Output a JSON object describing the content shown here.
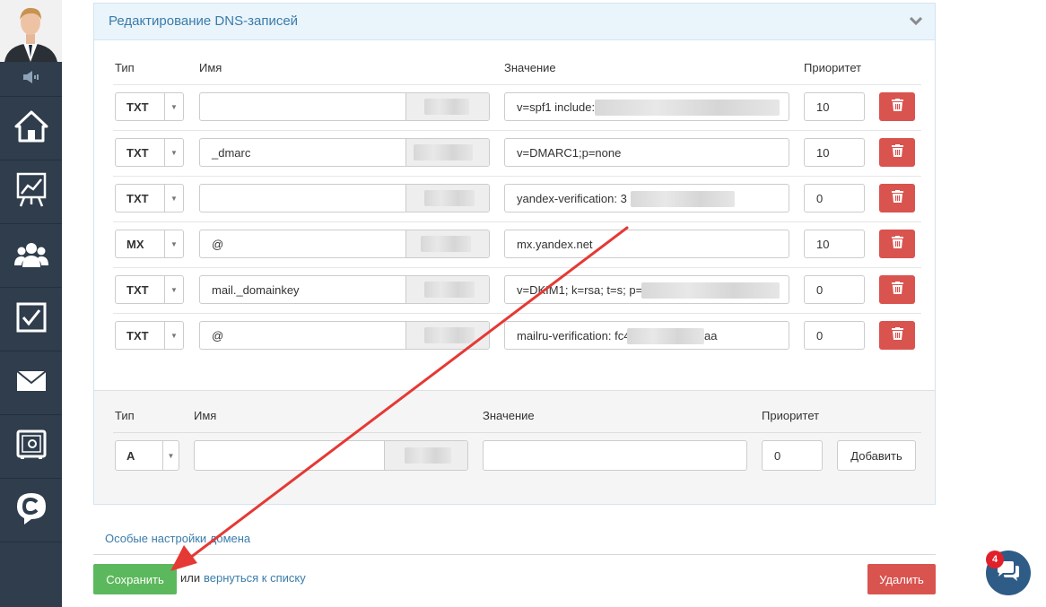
{
  "panel": {
    "title": "Редактирование DNS-записей"
  },
  "columns": {
    "type": "Тип",
    "name": "Имя",
    "value": "Значение",
    "priority": "Приоритет"
  },
  "records": [
    {
      "type": "TXT",
      "name": "",
      "value": "v=spf1 include:",
      "priority": "10"
    },
    {
      "type": "TXT",
      "name": "_dmarc",
      "value": "v=DMARC1;p=none",
      "priority": "10"
    },
    {
      "type": "TXT",
      "name": "",
      "value": "yandex-verification: 3",
      "priority": "0"
    },
    {
      "type": "MX",
      "name": "@",
      "value": "mx.yandex.net",
      "priority": "10"
    },
    {
      "type": "TXT",
      "name": "mail._domainkey",
      "value": "v=DKIM1; k=rsa; t=s; p=M",
      "priority": "0"
    },
    {
      "type": "TXT",
      "name": "@",
      "value": "mailru-verification: fc4",
      "value_tail": "aa",
      "priority": "0"
    }
  ],
  "new_record": {
    "type": "A",
    "name": "",
    "value": "",
    "priority": "0",
    "add_label": "Добавить"
  },
  "footer": {
    "special_settings": "Особые настройки домена",
    "save_label": "Сохранить",
    "or_text": "или",
    "back_link": "вернуться к списку",
    "delete_label": "Удалить"
  },
  "chat": {
    "badge_count": "4"
  },
  "colors": {
    "sidebar": "#2f3d4c",
    "accent_link": "#3a7cab",
    "danger": "#d9534f",
    "success": "#5cb85c",
    "annotation_arrow": "#e53935"
  },
  "icons": [
    "speaker-icon",
    "home-icon",
    "chart-icon",
    "users-icon",
    "checkbox-icon",
    "mail-icon",
    "safe-icon",
    "c-logo-icon",
    "chevron-down-icon",
    "trash-icon",
    "chat-icon"
  ]
}
